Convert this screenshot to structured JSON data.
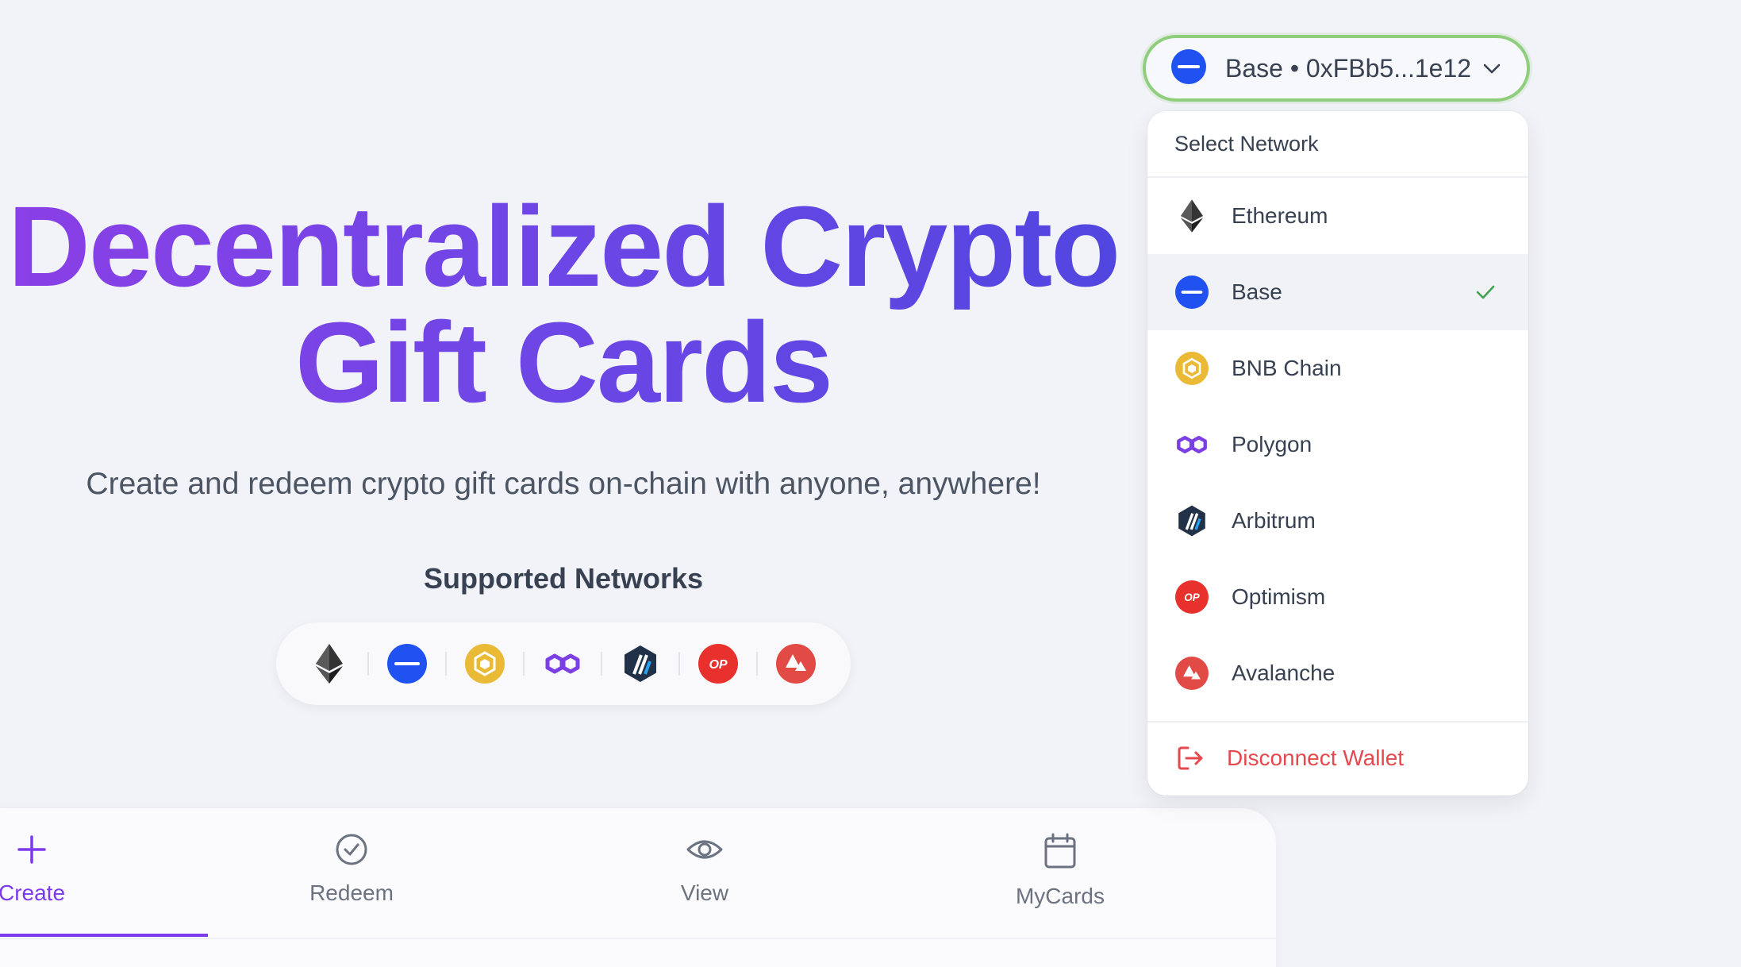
{
  "hero": {
    "title_line1": "Decentralized Crypto",
    "title_line2": "Gift Cards",
    "subtitle": "Create and redeem crypto gift cards on-chain with anyone, anywhere!",
    "supported_title": "Supported Networks"
  },
  "supported_networks": [
    "ethereum-icon",
    "base-icon",
    "bnb-chain-icon",
    "polygon-icon",
    "arbitrum-icon",
    "optimism-icon",
    "avalanche-icon"
  ],
  "wallet": {
    "label": "Base • 0xFBb5...1e12",
    "icon": "base-icon"
  },
  "dropdown": {
    "header": "Select Network",
    "items": [
      {
        "label": "Ethereum",
        "icon": "ethereum-icon",
        "selected": false
      },
      {
        "label": "Base",
        "icon": "base-icon",
        "selected": true
      },
      {
        "label": "BNB Chain",
        "icon": "bnb-chain-icon",
        "selected": false
      },
      {
        "label": "Polygon",
        "icon": "polygon-icon",
        "selected": false
      },
      {
        "label": "Arbitrum",
        "icon": "arbitrum-icon",
        "selected": false
      },
      {
        "label": "Optimism",
        "icon": "optimism-icon",
        "selected": false
      },
      {
        "label": "Avalanche",
        "icon": "avalanche-icon",
        "selected": false
      }
    ],
    "disconnect": "Disconnect Wallet"
  },
  "tabs": [
    {
      "label": "Create",
      "icon": "plus-icon",
      "active": true
    },
    {
      "label": "Redeem",
      "icon": "check-circle-icon",
      "active": false
    },
    {
      "label": "View",
      "icon": "eye-icon",
      "active": false
    },
    {
      "label": "MyCards",
      "icon": "calendar-icon",
      "active": false
    }
  ],
  "colors": {
    "accent": "#7c3aed",
    "base_blue": "#1f52f0",
    "bnb_yellow": "#eab935",
    "polygon_purple": "#7b3fe4",
    "optimism_red": "#e8312d",
    "avalanche_red": "#e24a45",
    "danger": "#e5484d",
    "wallet_border": "#8fce7d"
  }
}
